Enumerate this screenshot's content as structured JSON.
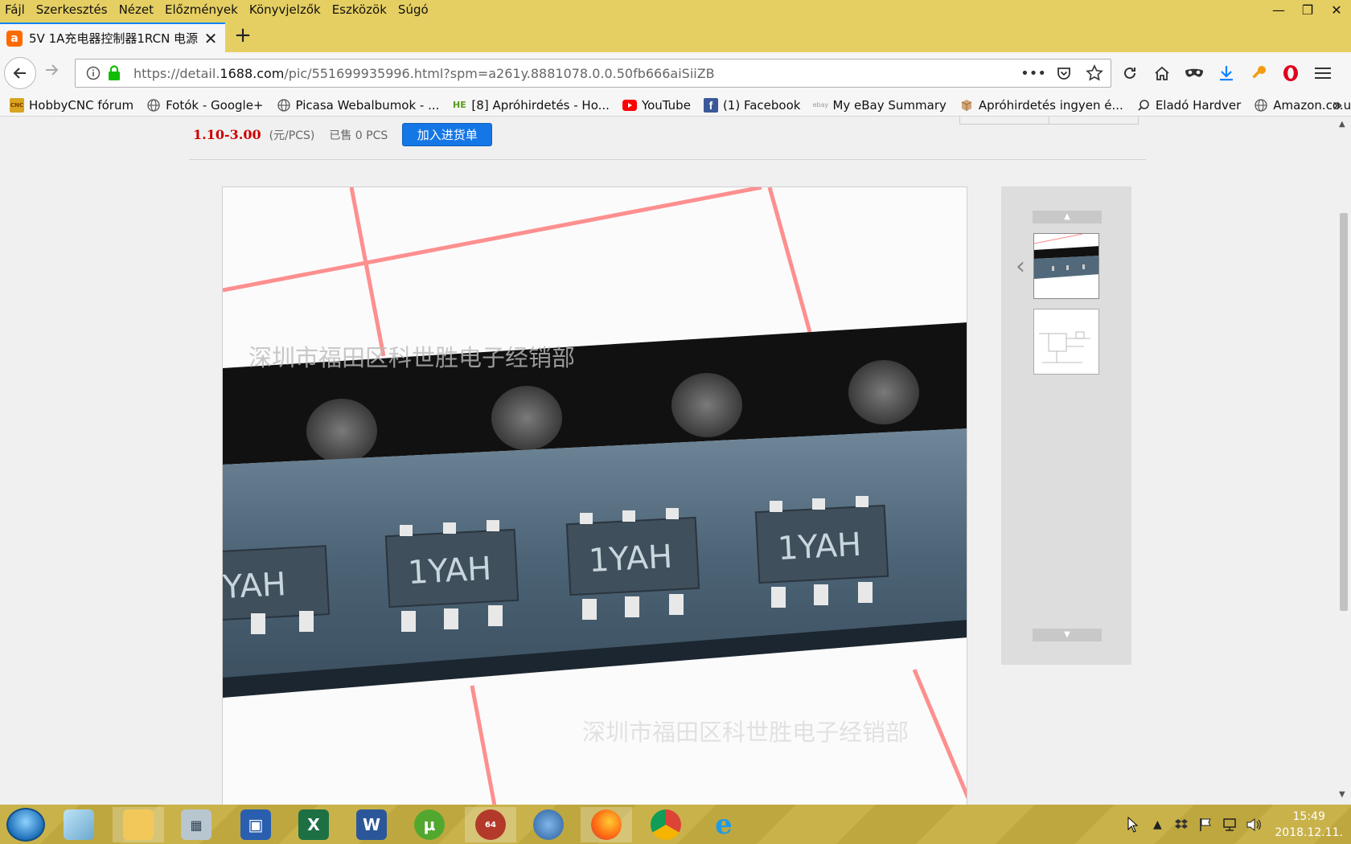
{
  "menu": {
    "items": [
      "Fájl",
      "Szerkesztés",
      "Nézet",
      "Előzmények",
      "Könyvjelzők",
      "Eszközök",
      "Súgó"
    ]
  },
  "window_controls": {
    "minimize": "—",
    "restore": "❐",
    "close": "✕"
  },
  "tab": {
    "favicon": "a",
    "title": "5V 1A充电器控制器1RCN 电源",
    "close": "✕",
    "new_tab": "+"
  },
  "url": {
    "prefix": "https://detail.",
    "host": "1688.com",
    "path": "/pic/551699935996.html?spm=a261y.8881078.0.0.50fb666aiSiiZB"
  },
  "bookmarks": [
    {
      "label": "HobbyCNC fórum",
      "icon": "CNC",
      "color": "#b08a1a"
    },
    {
      "label": "Fotók - Google+",
      "icon": "globe-icon",
      "color": "#555555"
    },
    {
      "label": "Picasa Webalbumok - ...",
      "icon": "globe-icon",
      "color": "#555555"
    },
    {
      "label": "[8] Apróhirdetés - Ho...",
      "icon": "HE",
      "color": "#5a9a1a"
    },
    {
      "label": "YouTube",
      "icon": "youtube-icon",
      "color": "#ff0000"
    },
    {
      "label": "(1) Facebook",
      "icon": "facebook-icon",
      "color": "#3b5998"
    },
    {
      "label": "My eBay Summary",
      "icon": "ebay",
      "color": "#999999"
    },
    {
      "label": "Apróhirdetés ingyen é...",
      "icon": "box-icon",
      "color": "#c58a5a"
    },
    {
      "label": "Eladó Hardver",
      "icon": "search-icon",
      "color": "#333333"
    },
    {
      "label": "Amazon.co.uk – Onlin...",
      "icon": "globe-icon",
      "color": "#555555"
    }
  ],
  "product": {
    "price": "1.10-3.00",
    "unit": "(元/PCS)",
    "sold": "已售 0 PCS",
    "add_button": "加入进货单"
  },
  "image": {
    "watermark": "深圳市福田区科世胜电子经销部",
    "chip_marking": "1YAH",
    "partial_marking": "YAH"
  },
  "taskbar": {
    "time": "15:49",
    "date": "2018.12.11.",
    "apps": [
      "windows-explorer",
      "notepad",
      "file-explorer",
      "calculator",
      "save",
      "excel",
      "word",
      "utorrent",
      "game-64",
      "thunderbird",
      "firefox",
      "chrome",
      "internet-explorer"
    ]
  },
  "colors": {
    "chrome_yellow": "#e6cf62",
    "price_red": "#cc0000",
    "button_blue": "#1577e6"
  }
}
